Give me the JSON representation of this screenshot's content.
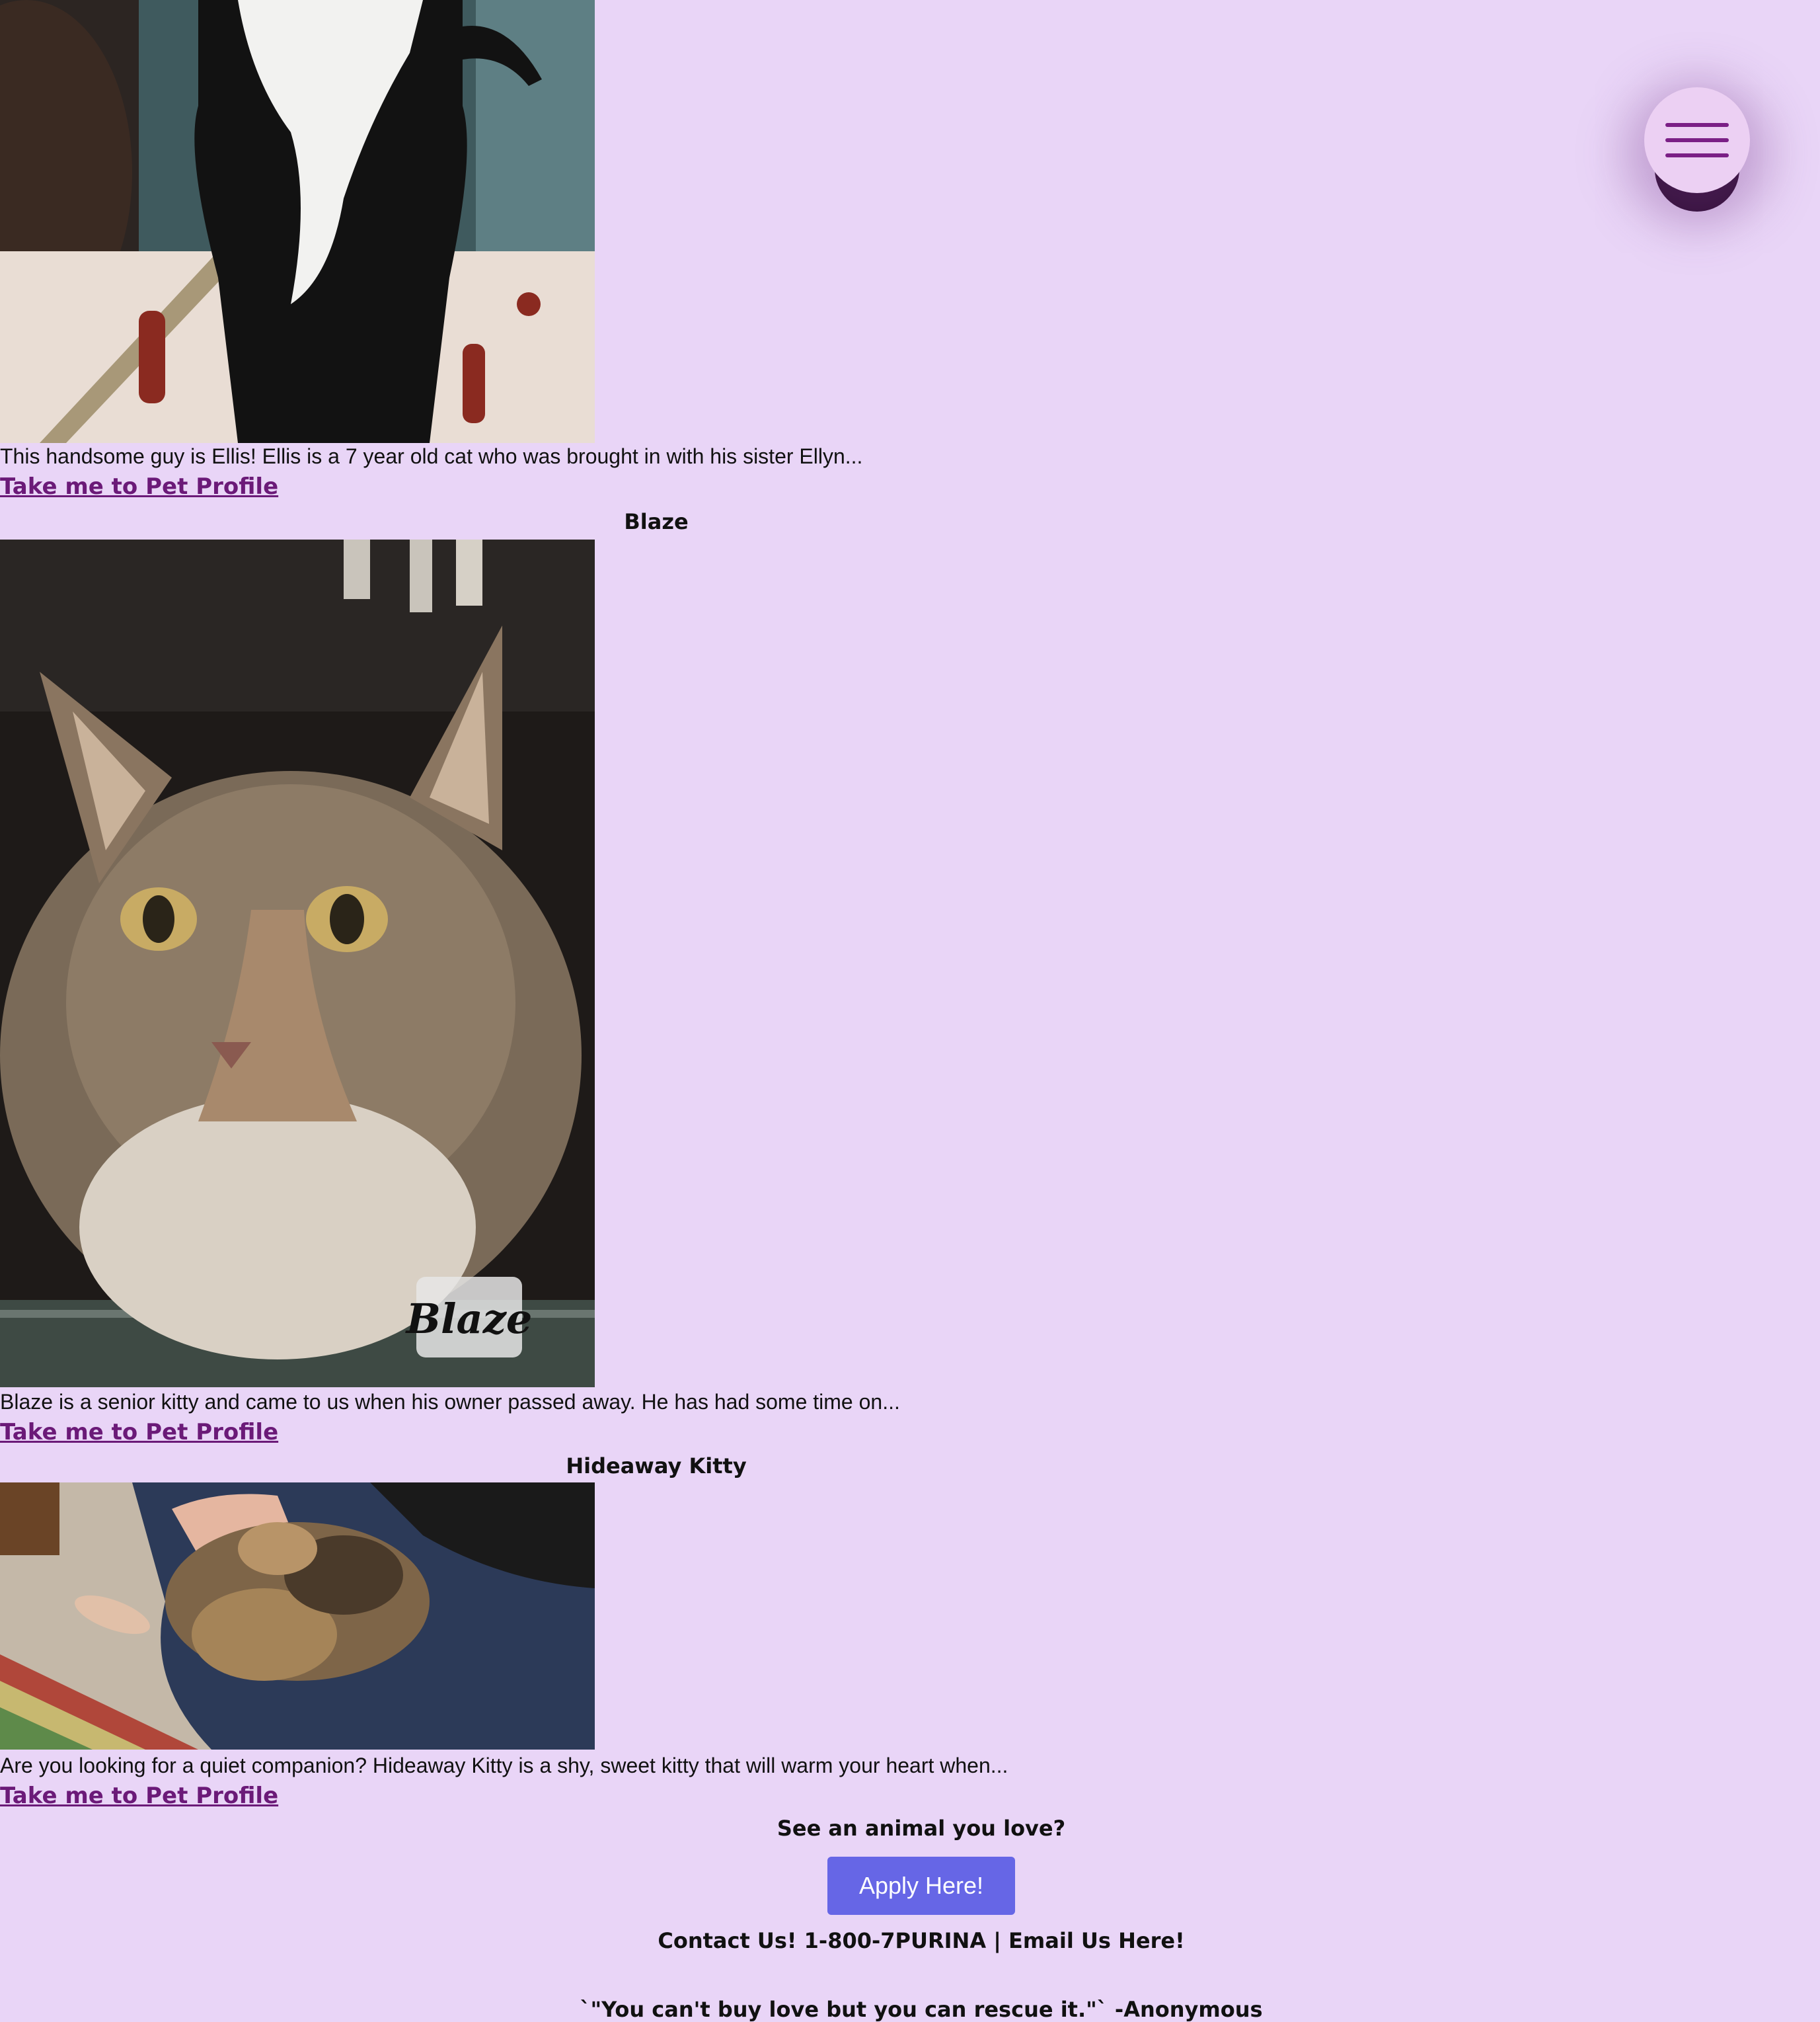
{
  "pets": [
    {
      "name": "",
      "image_alt": "Black and white cat standing on a bone-print blanket",
      "description": "This handsome guy is Ellis! Ellis is a 7 year old cat who was brought in with his sister Ellyn...",
      "link_label": "Take me to Pet Profile"
    },
    {
      "name": "Blaze",
      "image_alt": "Close-up of a long-haired tabby cat",
      "photo_caption": "Blaze",
      "description": "Blaze is a senior kitty and came to us when his owner passed away. He has had some time on...",
      "link_label": "Take me to Pet Profile"
    },
    {
      "name": "Hideaway Kitty",
      "image_alt": "Tortoiseshell cat curled up on a person's lap",
      "description": "Are you looking for a quiet companion? Hideaway Kitty is a shy, sweet kitty that will warm your heart when...",
      "link_label": "Take me to Pet Profile"
    }
  ],
  "footer": {
    "prompt": "See an animal you love?",
    "apply_label": "Apply Here!",
    "contact": "Contact Us! 1-800-7PURINA | Email Us Here!",
    "quote": "`\"You can't buy love but you can rescue it.\"` -Anonymous"
  },
  "menu": {
    "icon": "hamburger-menu-icon"
  },
  "colors": {
    "background": "#e9d5f7",
    "link": "#6b1a78",
    "button": "#6666e6",
    "menu_button": "#ecd0f3",
    "menu_bars": "#7b1f86"
  }
}
